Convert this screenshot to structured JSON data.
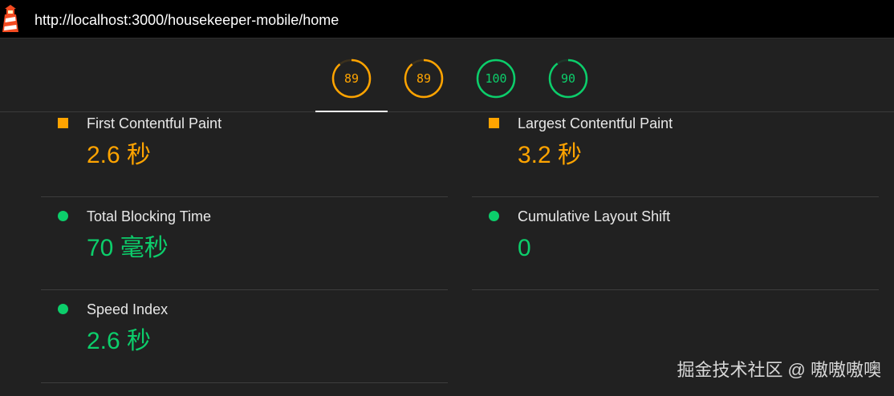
{
  "browser": {
    "url": "http://localhost:3000/housekeeper-mobile/home",
    "logo_icon": "lighthouse-icon"
  },
  "colors": {
    "average": "#ffa400",
    "pass": "#0cce6b",
    "background": "#212121",
    "topbar": "#000000"
  },
  "gauges": [
    {
      "score": "89",
      "fraction": 0.89,
      "status": "average"
    },
    {
      "score": "89",
      "fraction": 0.89,
      "status": "average"
    },
    {
      "score": "100",
      "fraction": 1.0,
      "status": "pass"
    },
    {
      "score": "90",
      "fraction": 0.9,
      "status": "pass"
    }
  ],
  "metrics": [
    {
      "label": "First Contentful Paint",
      "value": "2.6 秒",
      "status": "average",
      "marker_icon": "square-icon"
    },
    {
      "label": "Largest Contentful Paint",
      "value": "3.2 秒",
      "status": "average",
      "marker_icon": "square-icon"
    },
    {
      "label": "Total Blocking Time",
      "value": "70 毫秒",
      "status": "pass",
      "marker_icon": "circle-icon"
    },
    {
      "label": "Cumulative Layout Shift",
      "value": "0",
      "status": "pass",
      "marker_icon": "circle-icon"
    },
    {
      "label": "Speed Index",
      "value": "2.6 秒",
      "status": "pass",
      "marker_icon": "circle-icon"
    }
  ],
  "watermark": "掘金技术社区 @ 嗷嗷嗷噢"
}
